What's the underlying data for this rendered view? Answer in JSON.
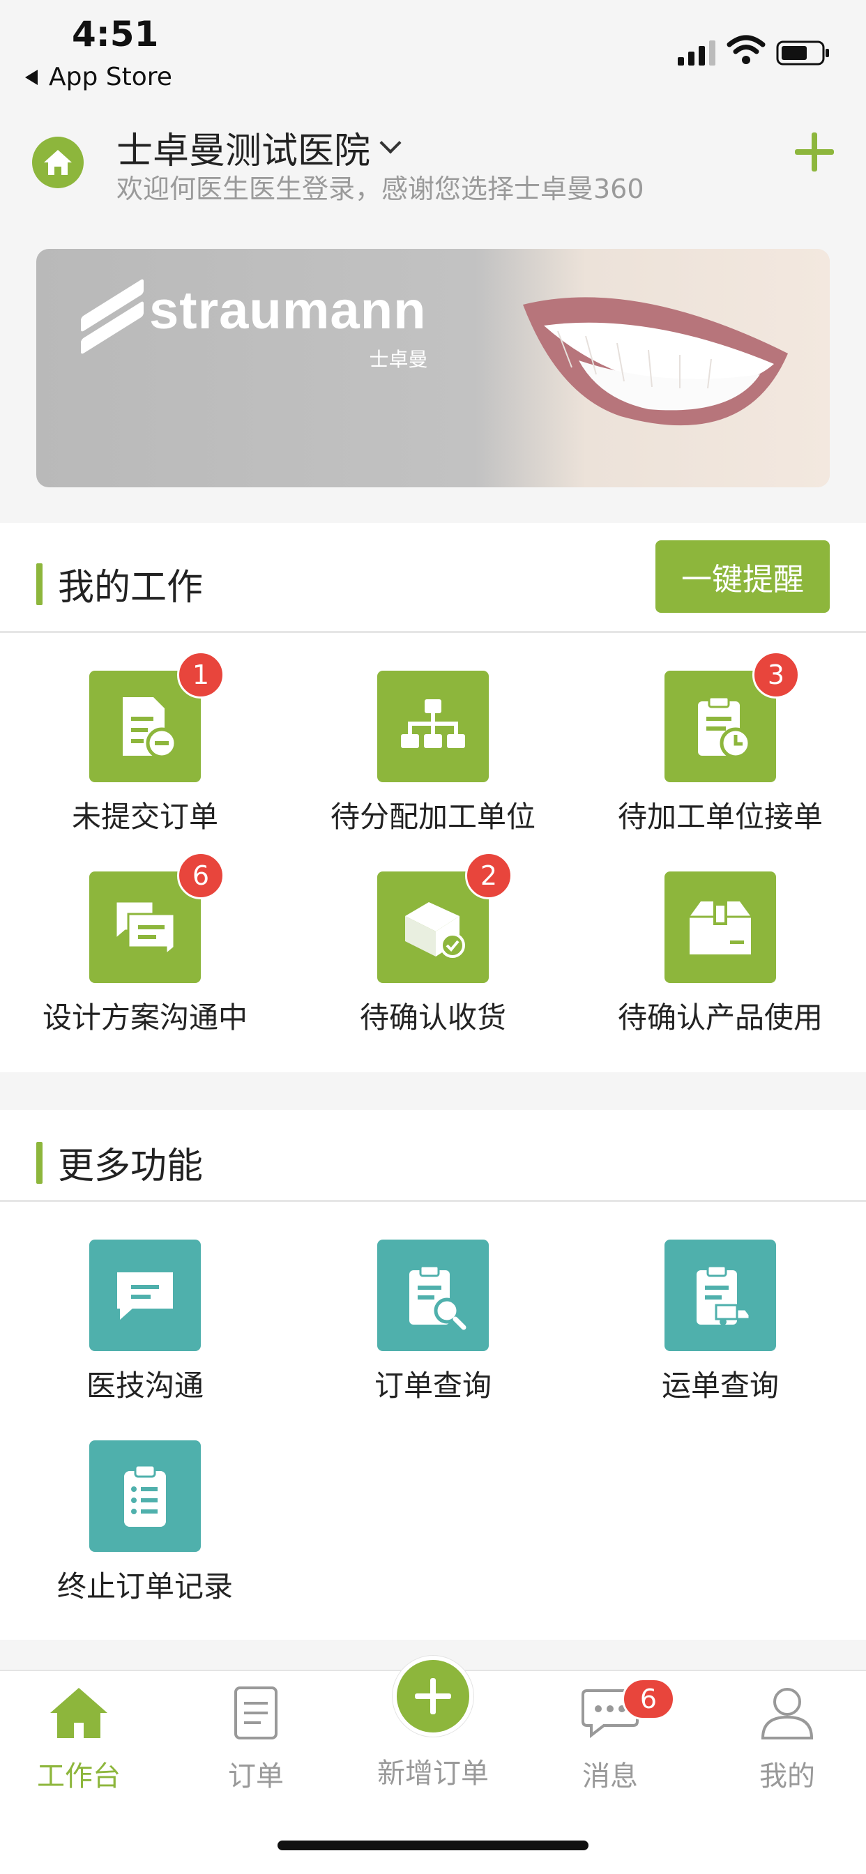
{
  "status_bar": {
    "time": "4:51",
    "back_app": "App Store"
  },
  "header": {
    "hospital_name": "士卓曼测试医院",
    "welcome_text": "欢迎何医生医生登录，感谢您选择士卓曼360"
  },
  "banner": {
    "brand_name": "straumann",
    "brand_sub": "士卓曼"
  },
  "my_work": {
    "title": "我的工作",
    "remind_button": "一键提醒",
    "items": [
      {
        "label": "未提交订单",
        "badge": "1",
        "icon": "document-minus-icon"
      },
      {
        "label": "待分配加工单位",
        "badge": "",
        "icon": "org-chart-icon"
      },
      {
        "label": "待加工单位接单",
        "badge": "3",
        "icon": "clipboard-clock-icon"
      },
      {
        "label": "设计方案沟通中",
        "badge": "6",
        "icon": "chat-bubbles-icon"
      },
      {
        "label": "待确认收货",
        "badge": "2",
        "icon": "box-check-icon"
      },
      {
        "label": "待确认产品使用",
        "badge": "",
        "icon": "package-icon"
      }
    ]
  },
  "more_functions": {
    "title": "更多功能",
    "items": [
      {
        "label": "医技沟通",
        "icon": "message-icon"
      },
      {
        "label": "订单查询",
        "icon": "clipboard-search-icon"
      },
      {
        "label": "运单查询",
        "icon": "clipboard-truck-icon"
      },
      {
        "label": "终止订单记录",
        "icon": "clipboard-list-icon"
      }
    ]
  },
  "tabbar": {
    "items": [
      {
        "label": "工作台",
        "icon": "home-icon",
        "active": true
      },
      {
        "label": "订单",
        "icon": "document-icon",
        "active": false
      },
      {
        "label": "新增订单",
        "icon": "plus-circle-icon",
        "active": false
      },
      {
        "label": "消息",
        "icon": "chat-icon",
        "active": false,
        "badge": "6"
      },
      {
        "label": "我的",
        "icon": "user-icon",
        "active": false
      }
    ]
  },
  "colors": {
    "accent": "#8db63c",
    "teal": "#4fb0ac",
    "badge": "#e8453c"
  }
}
